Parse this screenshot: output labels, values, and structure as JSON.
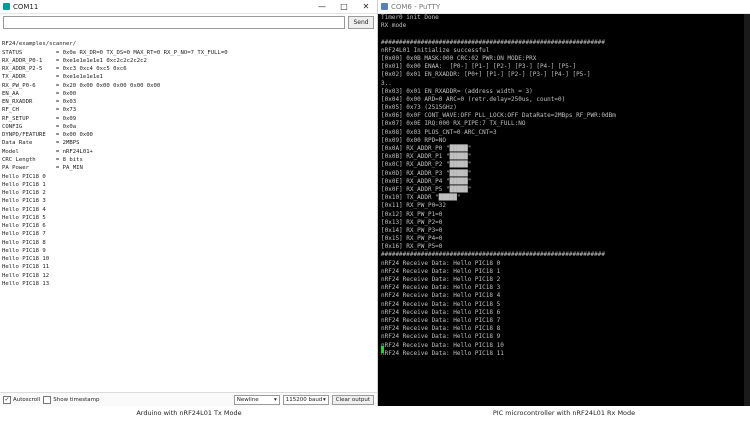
{
  "left_window": {
    "title": "COM11",
    "send_label": "Send",
    "lines": [
      "",
      "RF24/examples/scanner/",
      "STATUS          = 0x0e RX_DR=0 TX_DS=0 MAX_RT=0 RX_P_NO=7 TX_FULL=0",
      "RX_ADDR_P0-1    = 0xe1e1e1e1e1 0xc2c2c2c2c2",
      "RX_ADDR_P2-5    = 0xc3 0xc4 0xc5 0xc6",
      "TX_ADDR         = 0xe1e1e1e1e1",
      "RX_PW_P0-6      = 0x20 0x00 0x00 0x00 0x00 0x00",
      "EN_AA           = 0x00",
      "EN_RXADDR       = 0x03",
      "RF_CH           = 0x73",
      "RF_SETUP        = 0x09",
      "CONFIG          = 0x0a",
      "DYNPD/FEATURE   = 0x00 0x00",
      "Data Rate       = 2MBPS",
      "Model           = nRF24L01+",
      "CRC Length      = 8 bits",
      "PA Power        = PA_MIN",
      "Hello PIC18 0",
      "Hello PIC18 1",
      "Hello PIC18 2",
      "Hello PIC18 3",
      "Hello PIC18 4",
      "Hello PIC18 5",
      "Hello PIC18 6",
      "Hello PIC18 7",
      "Hello PIC18 8",
      "Hello PIC18 9",
      "Hello PIC18 10",
      "Hello PIC18 11",
      "Hello PIC18 12",
      "Hello PIC18 13"
    ],
    "autoscroll_label": "Autoscroll",
    "timestamp_label": "Show timestamp",
    "line_ending": "Newline",
    "baud": "115200 baud",
    "clear_label": "Clear output"
  },
  "right_window": {
    "title": "COM6 - PuTTY",
    "lines": [
      "Timer0 init Done",
      "RX mode",
      "",
      "##############################################################",
      "nRF24L01 Initialize successful",
      "[0x00] 0x0B MASK:000 CRC:02 PWR:ON MODE:PRX",
      "[0x01] 0x00 ENAA:  [P0-] [P1-] [P2-] [P3-] [P4-] [P5-]",
      "[0x02] 0x01 EN_RXADDR: [P0+] [P1-] [P2-] [P3-] [P4-] [P5-]",
      "3..",
      "[0x03] 0x01 EN_RXADDR= (address width = 3)",
      "[0x04] 0x00 ARD=0 ARC=0 (retr.delay=250us, count=0)",
      "[0x05] 0x73 (2515GHz)",
      "[0x06] 0x0F CONT_WAVE:OFF PLL_LOCK:OFF DataRate=2MBps RF_PWR:0dBm",
      "[0x07] 0x0E IRQ:000 RX_PIPE:7 TX_FULL:NO",
      "[0x08] 0x03 PLOS_CNT=0 ARC_CNT=3",
      "[0x09] 0x00 RPD=NO",
      "[0x0A] RX_ADDR_P0 \"█████\"",
      "[0x0B] RX_ADDR_P1 \"█████\"",
      "[0x0C] RX_ADDR_P2 \"█████\"",
      "[0x0D] RX_ADDR_P3 \"█████\"",
      "[0x0E] RX_ADDR_P4 \"█████\"",
      "[0x0F] RX_ADDR_P5 \"█████\"",
      "[0x10] TX_ADDR \"█████\"",
      "[0x11] RX_PW_P0=32",
      "[0x12] RX_PW_P1=0",
      "[0x13] RX_PW_P2=0",
      "[0x14] RX_PW_P3=0",
      "[0x15] RX_PW_P4=0",
      "[0x16] RX_PW_P5=0",
      "##############################################################",
      "nRF24 Receive Data: Hello PIC18 0",
      "nRF24 Receive Data: Hello PIC18 1",
      "nRF24 Receive Data: Hello PIC18 2",
      "nRF24 Receive Data: Hello PIC18 3",
      "nRF24 Receive Data: Hello PIC18 4",
      "nRF24 Receive Data: Hello PIC18 5",
      "nRF24 Receive Data: Hello PIC18 6",
      "nRF24 Receive Data: Hello PIC18 7",
      "nRF24 Receive Data: Hello PIC18 8",
      "nRF24 Receive Data: Hello PIC18 9",
      "nRF24 Receive Data: Hello PIC18 10",
      "nRF24 Receive Data: Hello PIC18 11",
      "nRF24 Receive Data: Hello PIC18 12"
    ]
  },
  "captions": {
    "left": "Arduino with nRF24L01 Tx Mode",
    "right": "PIC microcontroller with nRF24L01 Rx Mode"
  },
  "colors": {
    "arduino_accent": "#00979d",
    "putty_background": "#000000",
    "putty_text": "#c0c0c0",
    "putty_cursor": "#2ecc40"
  }
}
